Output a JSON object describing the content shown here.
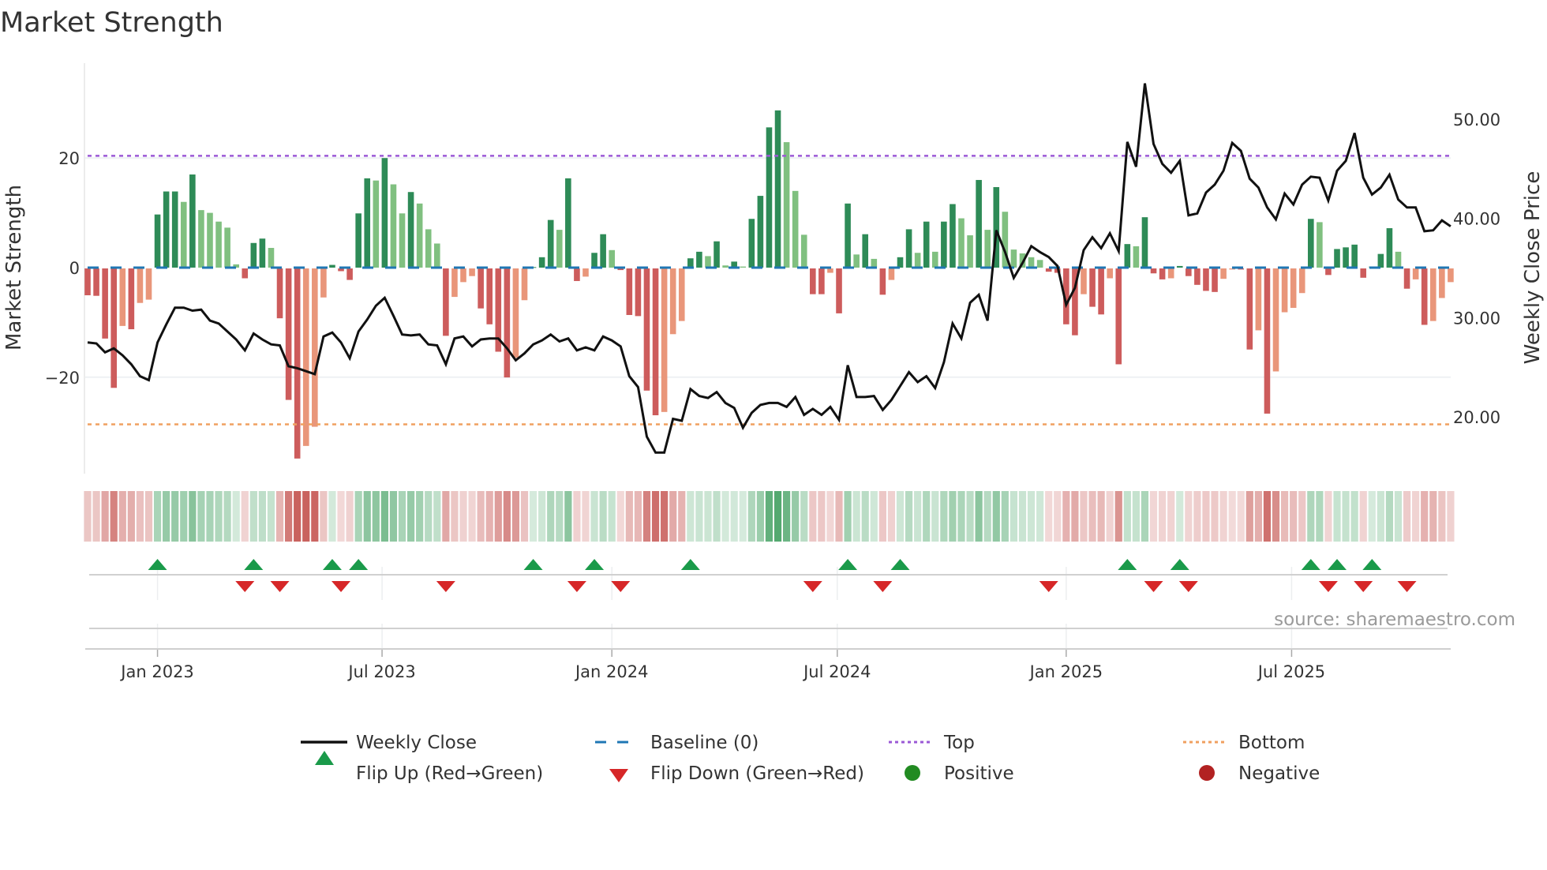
{
  "chart_data": {
    "type": "bar",
    "title": "Market Strength",
    "ylabel": "Market Strength",
    "y2label": "Weekly Close Price",
    "ylim": [
      -37.5,
      37.3
    ],
    "y2lim": [
      14.3,
      55.6
    ],
    "yticks": [
      {
        "v": 20,
        "label": "20"
      },
      {
        "v": 0,
        "label": "0"
      },
      {
        "v": -20,
        "label": "−20"
      }
    ],
    "y2ticks": [
      {
        "v": 50,
        "label": "50.00"
      },
      {
        "v": 40,
        "label": "40.00"
      },
      {
        "v": 30,
        "label": "30.00"
      },
      {
        "v": 20,
        "label": "20.00"
      }
    ],
    "xticks": [
      {
        "week": 8,
        "label": "Jan 2023"
      },
      {
        "week": 33.7,
        "label": "Jul 2023"
      },
      {
        "week": 60,
        "label": "Jan 2024"
      },
      {
        "week": 85.8,
        "label": "Jul 2024"
      },
      {
        "week": 112,
        "label": "Jan 2025"
      },
      {
        "week": 137.8,
        "label": "Jul 2025"
      }
    ],
    "top_level": 20.4,
    "bottom_level": -28.6,
    "baseline": 0,
    "strength": [
      -4.9,
      -5.0,
      -12.8,
      -21.8,
      -10.5,
      -11.1,
      -6.3,
      -5.7,
      9.7,
      13.9,
      13.9,
      12.0,
      17.0,
      10.5,
      10.0,
      8.4,
      7.3,
      0.6,
      -1.8,
      4.5,
      5.3,
      3.6,
      -9.1,
      -24.0,
      -34.7,
      -32.4,
      -28.9,
      -5.3,
      0.5,
      -0.5,
      -2.1,
      9.9,
      16.3,
      15.9,
      20.0,
      15.2,
      9.9,
      13.8,
      11.7,
      7.0,
      4.4,
      -12.3,
      -5.2,
      -2.5,
      -1.4,
      -7.3,
      -10.2,
      -15.2,
      -19.9,
      -16.3,
      -5.8,
      0.1,
      1.9,
      8.7,
      6.9,
      16.3,
      -2.3,
      -1.5,
      2.7,
      6.1,
      3.2,
      -0.3,
      -8.5,
      -8.7,
      -22.3,
      -26.8,
      -26.2,
      -12.0,
      -9.6,
      1.7,
      2.9,
      2.1,
      4.8,
      0.4,
      1.1,
      0.2,
      8.9,
      13.1,
      25.6,
      28.7,
      22.9,
      14.0,
      6.0,
      -4.7,
      -4.7,
      -0.8,
      -8.2,
      11.7,
      2.4,
      6.1,
      1.6,
      -4.8,
      -2.1,
      1.9,
      7.0,
      2.7,
      8.4,
      2.9,
      8.4,
      11.6,
      9.0,
      5.9,
      16.0,
      6.9,
      14.7,
      10.2,
      3.3,
      2.6,
      1.9,
      1.4,
      -0.6,
      -0.8,
      -10.2,
      -12.2,
      -4.7,
      -7.0,
      -8.4,
      -1.8,
      -17.5,
      4.3,
      3.9,
      9.2,
      -0.9,
      -2.0,
      -1.8,
      0.3,
      -1.4,
      -3.0,
      -4.1,
      -4.3,
      -1.9,
      -0.2,
      -0.2,
      -14.8,
      -11.3,
      -26.5,
      -18.8,
      -8.0,
      -7.2,
      -4.5,
      8.9,
      8.3,
      -1.2,
      3.4,
      3.7,
      4.2,
      -1.7,
      0.2,
      2.5,
      7.2,
      2.9,
      -3.7,
      -2.0,
      -10.3,
      -9.6,
      -5.4,
      -2.5
    ],
    "weekly_close": [
      27.5,
      27.4,
      26.5,
      26.9,
      26.2,
      25.3,
      24.1,
      23.7,
      27.5,
      29.3,
      31.0,
      31.0,
      30.7,
      30.8,
      29.7,
      29.4,
      28.6,
      27.8,
      26.7,
      28.4,
      27.8,
      27.3,
      27.2,
      25.1,
      24.9,
      24.6,
      24.3,
      28.1,
      28.5,
      27.5,
      25.9,
      28.6,
      29.8,
      31.2,
      32.0,
      30.2,
      28.3,
      28.2,
      28.3,
      27.3,
      27.2,
      25.3,
      27.9,
      28.1,
      27.1,
      27.8,
      27.9,
      27.9,
      26.9,
      25.7,
      26.4,
      27.3,
      27.7,
      28.3,
      27.6,
      27.9,
      26.7,
      27.0,
      26.7,
      28.1,
      27.7,
      27.1,
      24.1,
      23.0,
      18.0,
      16.4,
      16.4,
      19.8,
      19.6,
      22.8,
      22.1,
      21.9,
      22.5,
      21.4,
      20.9,
      18.9,
      20.4,
      21.2,
      21.4,
      21.4,
      21.0,
      22.0,
      20.2,
      20.8,
      20.2,
      21.0,
      19.7,
      25.2,
      22.0,
      22.0,
      22.1,
      20.7,
      21.7,
      23.1,
      24.5,
      23.5,
      24.1,
      22.9,
      25.5,
      29.4,
      27.9,
      31.5,
      32.3,
      29.7,
      38.8,
      36.6,
      34.0,
      35.5,
      37.2,
      36.6,
      36.1,
      35.2,
      31.3,
      33.0,
      36.8,
      38.1,
      37.0,
      38.5,
      36.7,
      47.7,
      45.2,
      53.6,
      47.5,
      45.5,
      44.6,
      45.8,
      40.3,
      40.5,
      42.6,
      43.4,
      44.8,
      47.6,
      46.8,
      44.0,
      43.1,
      41.1,
      39.9,
      42.5,
      41.4,
      43.4,
      44.2,
      44.1,
      41.8,
      44.8,
      45.8,
      48.6,
      44.1,
      42.4,
      43.1,
      44.4,
      41.9,
      41.1,
      41.1,
      38.7,
      38.8,
      39.8,
      39.2
    ],
    "flip_up_weeks": [
      8,
      19,
      28,
      31,
      51,
      58,
      69,
      87,
      93,
      119,
      125,
      140,
      143,
      147
    ],
    "flip_down_weeks": [
      18,
      22,
      29,
      41,
      56,
      61,
      83,
      91,
      110,
      122,
      126,
      142,
      146,
      151
    ],
    "legend": [
      {
        "key": "close",
        "label": "Weekly Close"
      },
      {
        "key": "baseline",
        "label": "Baseline (0)"
      },
      {
        "key": "top",
        "label": "Top"
      },
      {
        "key": "bottom",
        "label": "Bottom"
      },
      {
        "key": "flipup",
        "label": "Flip Up (Red→Green)"
      },
      {
        "key": "flipdown",
        "label": "Flip Down (Green→Red)"
      },
      {
        "key": "positive",
        "label": "Positive"
      },
      {
        "key": "negative",
        "label": "Negative"
      }
    ],
    "legend_placement": "bottom",
    "source": "source: sharemaestro.com",
    "colors": {
      "green_strong": "#2e8b57",
      "green_weak": "#80c080",
      "red_strong": "#cd5c5c",
      "red_weak": "#e9967a",
      "close": "#111111",
      "baseline": "#1f77b4",
      "top": "#9b59d6",
      "bottom": "#f0a060",
      "flip_up": "#1a9a4a",
      "flip_down": "#d62728",
      "positive": "#228b22",
      "negative": "#b22222"
    }
  }
}
